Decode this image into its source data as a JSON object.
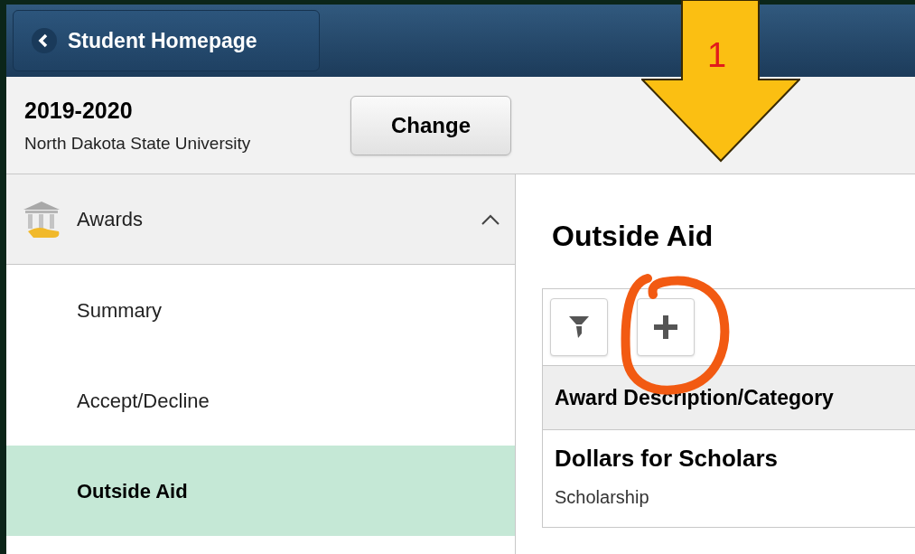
{
  "header": {
    "back_button": "Student Homepage"
  },
  "context": {
    "year": "2019-2020",
    "institution": "North Dakota State University",
    "change_button": "Change"
  },
  "nav": {
    "section": {
      "label": "Awards",
      "expanded": true
    },
    "items": [
      {
        "label": "Summary",
        "selected": false
      },
      {
        "label": "Accept/Decline",
        "selected": false
      },
      {
        "label": "Outside Aid",
        "selected": true
      }
    ]
  },
  "content": {
    "title": "Outside Aid",
    "table": {
      "columns": [
        "Award Description/Category"
      ],
      "rows": [
        {
          "title": "Dollars for Scholars",
          "category": "Scholarship"
        }
      ]
    }
  },
  "annotations": [
    {
      "kind": "arrow",
      "label": "1"
    },
    {
      "kind": "circle"
    }
  ]
}
